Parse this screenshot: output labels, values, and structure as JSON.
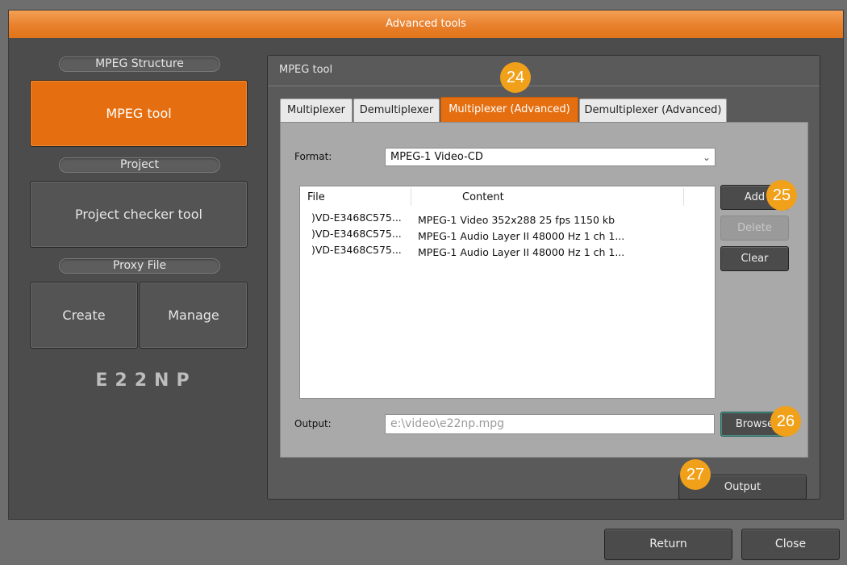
{
  "window": {
    "title": "Advanced tools"
  },
  "left": {
    "sections": [
      {
        "heading": "MPEG Structure",
        "buttons": [
          "MPEG tool"
        ]
      },
      {
        "heading": "Project",
        "buttons": [
          "Project checker tool"
        ]
      },
      {
        "heading": "Proxy File",
        "buttons": [
          "Create",
          "Manage"
        ]
      }
    ],
    "logo": "E22NP"
  },
  "panel": {
    "title": "MPEG tool",
    "tabs": [
      "Multiplexer",
      "Demultiplexer",
      "Multiplexer (Advanced)",
      "Demultiplexer (Advanced)"
    ],
    "active_tab": "Multiplexer (Advanced)",
    "format_label": "Format:",
    "format_value": "MPEG-1 Video-CD",
    "list": {
      "headers": [
        "File",
        "Content"
      ],
      "rows": [
        {
          "file": ")VD-E3468C575...",
          "content": "MPEG-1 Video 352x288 25 fps 1150 kb"
        },
        {
          "file": ")VD-E3468C575...",
          "content": "MPEG-1 Audio Layer II 48000 Hz 1 ch 1..."
        },
        {
          "file": ")VD-E3468C575...",
          "content": "MPEG-1 Audio Layer II 48000 Hz 1 ch 1..."
        }
      ]
    },
    "side_buttons": {
      "add": "Add",
      "delete": "Delete",
      "clear": "Clear"
    },
    "output_label": "Output:",
    "output_placeholder": "e:\\video\\e22np.mpg",
    "browse": "Browse",
    "output_button": "Output"
  },
  "footer": {
    "return": "Return",
    "close": "Close"
  },
  "callouts": [
    "24",
    "25",
    "26",
    "27"
  ],
  "colors": {
    "accent": "#e56f10",
    "badge": "#f1a01a",
    "titlebar": "#e8802c"
  }
}
